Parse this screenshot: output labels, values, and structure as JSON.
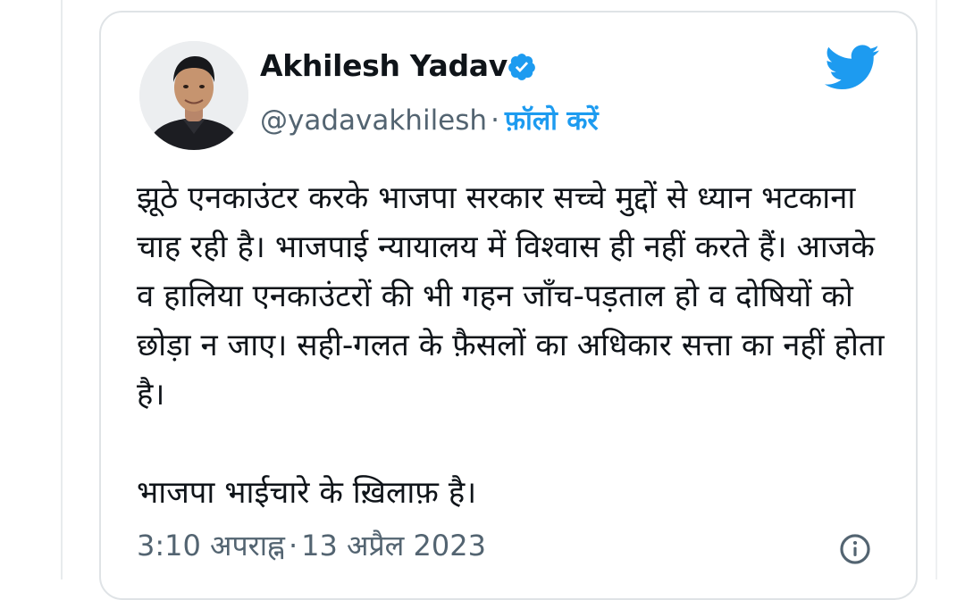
{
  "tweet": {
    "author_name": "Akhilesh Yadav",
    "handle": "@yadavakhilesh",
    "separator": "·",
    "follow_label": "फ़ॉलो करें",
    "text_paragraphs": [
      "झूठे एनकाउंटर करके भाजपा सरकार सच्चे मुद्दों से ध्यान भटकाना चाह रही है। भाजपाई न्यायालय में विश्वास ही नहीं करते हैं। आजके व हालिया एनकाउंटरों की भी गहन जाँच-पड़ताल हो व दोषियों को छोड़ा न जाए। सही-गलत के फ़ैसलों का अधिकार सत्ता का नहीं होता है।",
      "भाजपा भाईचारे के ख़िलाफ़ है।"
    ],
    "time": "3:10 अपराह्न",
    "date": "13 अप्रैल 2023"
  },
  "icons": {
    "verified": "verified-badge-icon",
    "brand": "twitter-bird-icon",
    "info": "info-icon"
  },
  "colors": {
    "accent": "#1d9bf0",
    "text": "#0f1419",
    "secondary": "#536471",
    "border": "#dfe3e6"
  }
}
